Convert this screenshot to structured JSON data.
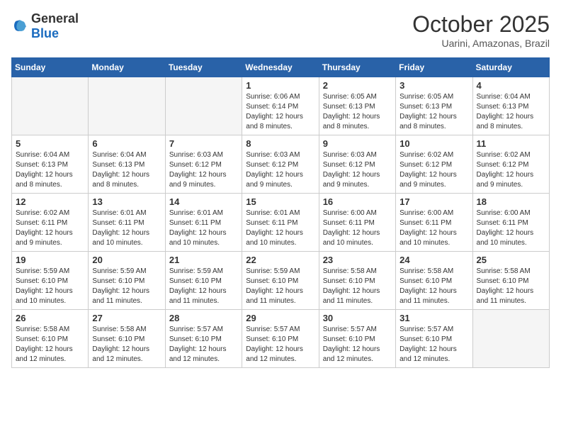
{
  "header": {
    "logo_general": "General",
    "logo_blue": "Blue",
    "month_title": "October 2025",
    "location": "Uarini, Amazonas, Brazil"
  },
  "weekdays": [
    "Sunday",
    "Monday",
    "Tuesday",
    "Wednesday",
    "Thursday",
    "Friday",
    "Saturday"
  ],
  "weeks": [
    [
      {
        "day": "",
        "info": ""
      },
      {
        "day": "",
        "info": ""
      },
      {
        "day": "",
        "info": ""
      },
      {
        "day": "1",
        "info": "Sunrise: 6:06 AM\nSunset: 6:14 PM\nDaylight: 12 hours\nand 8 minutes."
      },
      {
        "day": "2",
        "info": "Sunrise: 6:05 AM\nSunset: 6:13 PM\nDaylight: 12 hours\nand 8 minutes."
      },
      {
        "day": "3",
        "info": "Sunrise: 6:05 AM\nSunset: 6:13 PM\nDaylight: 12 hours\nand 8 minutes."
      },
      {
        "day": "4",
        "info": "Sunrise: 6:04 AM\nSunset: 6:13 PM\nDaylight: 12 hours\nand 8 minutes."
      }
    ],
    [
      {
        "day": "5",
        "info": "Sunrise: 6:04 AM\nSunset: 6:13 PM\nDaylight: 12 hours\nand 8 minutes."
      },
      {
        "day": "6",
        "info": "Sunrise: 6:04 AM\nSunset: 6:13 PM\nDaylight: 12 hours\nand 8 minutes."
      },
      {
        "day": "7",
        "info": "Sunrise: 6:03 AM\nSunset: 6:12 PM\nDaylight: 12 hours\nand 9 minutes."
      },
      {
        "day": "8",
        "info": "Sunrise: 6:03 AM\nSunset: 6:12 PM\nDaylight: 12 hours\nand 9 minutes."
      },
      {
        "day": "9",
        "info": "Sunrise: 6:03 AM\nSunset: 6:12 PM\nDaylight: 12 hours\nand 9 minutes."
      },
      {
        "day": "10",
        "info": "Sunrise: 6:02 AM\nSunset: 6:12 PM\nDaylight: 12 hours\nand 9 minutes."
      },
      {
        "day": "11",
        "info": "Sunrise: 6:02 AM\nSunset: 6:12 PM\nDaylight: 12 hours\nand 9 minutes."
      }
    ],
    [
      {
        "day": "12",
        "info": "Sunrise: 6:02 AM\nSunset: 6:11 PM\nDaylight: 12 hours\nand 9 minutes."
      },
      {
        "day": "13",
        "info": "Sunrise: 6:01 AM\nSunset: 6:11 PM\nDaylight: 12 hours\nand 10 minutes."
      },
      {
        "day": "14",
        "info": "Sunrise: 6:01 AM\nSunset: 6:11 PM\nDaylight: 12 hours\nand 10 minutes."
      },
      {
        "day": "15",
        "info": "Sunrise: 6:01 AM\nSunset: 6:11 PM\nDaylight: 12 hours\nand 10 minutes."
      },
      {
        "day": "16",
        "info": "Sunrise: 6:00 AM\nSunset: 6:11 PM\nDaylight: 12 hours\nand 10 minutes."
      },
      {
        "day": "17",
        "info": "Sunrise: 6:00 AM\nSunset: 6:11 PM\nDaylight: 12 hours\nand 10 minutes."
      },
      {
        "day": "18",
        "info": "Sunrise: 6:00 AM\nSunset: 6:11 PM\nDaylight: 12 hours\nand 10 minutes."
      }
    ],
    [
      {
        "day": "19",
        "info": "Sunrise: 5:59 AM\nSunset: 6:10 PM\nDaylight: 12 hours\nand 10 minutes."
      },
      {
        "day": "20",
        "info": "Sunrise: 5:59 AM\nSunset: 6:10 PM\nDaylight: 12 hours\nand 11 minutes."
      },
      {
        "day": "21",
        "info": "Sunrise: 5:59 AM\nSunset: 6:10 PM\nDaylight: 12 hours\nand 11 minutes."
      },
      {
        "day": "22",
        "info": "Sunrise: 5:59 AM\nSunset: 6:10 PM\nDaylight: 12 hours\nand 11 minutes."
      },
      {
        "day": "23",
        "info": "Sunrise: 5:58 AM\nSunset: 6:10 PM\nDaylight: 12 hours\nand 11 minutes."
      },
      {
        "day": "24",
        "info": "Sunrise: 5:58 AM\nSunset: 6:10 PM\nDaylight: 12 hours\nand 11 minutes."
      },
      {
        "day": "25",
        "info": "Sunrise: 5:58 AM\nSunset: 6:10 PM\nDaylight: 12 hours\nand 11 minutes."
      }
    ],
    [
      {
        "day": "26",
        "info": "Sunrise: 5:58 AM\nSunset: 6:10 PM\nDaylight: 12 hours\nand 12 minutes."
      },
      {
        "day": "27",
        "info": "Sunrise: 5:58 AM\nSunset: 6:10 PM\nDaylight: 12 hours\nand 12 minutes."
      },
      {
        "day": "28",
        "info": "Sunrise: 5:57 AM\nSunset: 6:10 PM\nDaylight: 12 hours\nand 12 minutes."
      },
      {
        "day": "29",
        "info": "Sunrise: 5:57 AM\nSunset: 6:10 PM\nDaylight: 12 hours\nand 12 minutes."
      },
      {
        "day": "30",
        "info": "Sunrise: 5:57 AM\nSunset: 6:10 PM\nDaylight: 12 hours\nand 12 minutes."
      },
      {
        "day": "31",
        "info": "Sunrise: 5:57 AM\nSunset: 6:10 PM\nDaylight: 12 hours\nand 12 minutes."
      },
      {
        "day": "",
        "info": ""
      }
    ]
  ]
}
